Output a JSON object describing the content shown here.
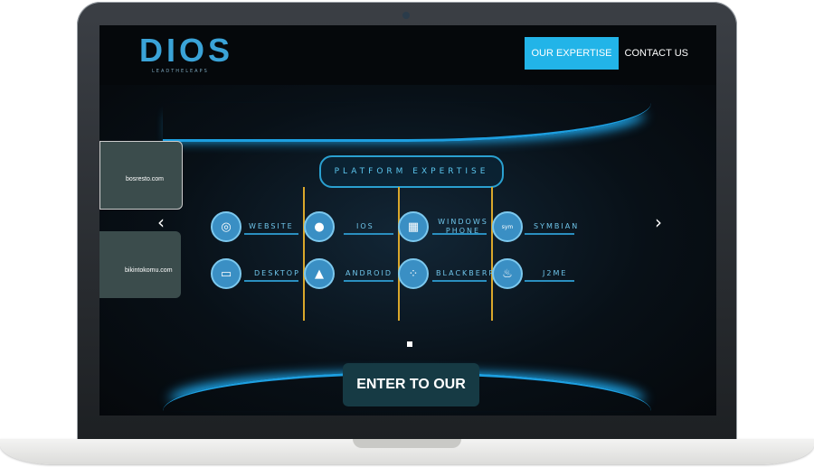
{
  "brand": {
    "name": "DIOS",
    "tagline": "LEADTHELEAPS"
  },
  "nav": {
    "items": [
      {
        "label": "OUR EXPERTISE"
      },
      {
        "label": "CONTACT US"
      }
    ]
  },
  "slider": {
    "title": "PLATFORM EXPERTISE",
    "platforms": [
      "WEBSITE",
      "IOS",
      "WINDOWS PHONE",
      "SYMBIAN",
      "DESKTOP",
      "ANDROID",
      "BLACKBERRY",
      "J2ME"
    ],
    "thumbs": [
      {
        "label": "bosresto.com"
      },
      {
        "label": "bikintokomu.com"
      }
    ],
    "prev_arrow": "‹",
    "next_arrow": "›"
  },
  "cta": {
    "label": "ENTER TO OUR WORLD"
  },
  "colors": {
    "accent": "#22b4e8",
    "gold": "#d9a72b"
  }
}
